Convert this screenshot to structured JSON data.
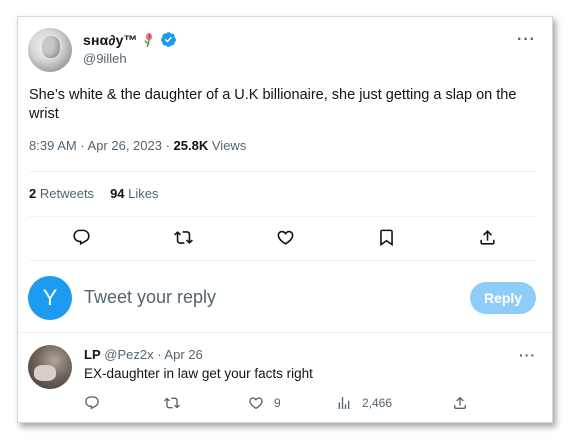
{
  "tweet": {
    "display_name": "ѕнα∂у™",
    "handle": "@9illeh",
    "text": "She’s white & the daughter of a U.K billionaire, she just getting a slap on the wrist",
    "time": "8:39 AM · Apr 26, 2023 ·",
    "views_count": "25.8K",
    "views_label": "Views",
    "retweets_count": "2",
    "retweets_label": "Retweets",
    "likes_count": "94",
    "likes_label": "Likes",
    "more": "···"
  },
  "composer": {
    "avatar_letter": "Y",
    "placeholder": "Tweet your reply",
    "reply_button": "Reply"
  },
  "reply": {
    "name": "LP",
    "handle_date": "@Pez2x · Apr 26",
    "text": "EX-daughter in law get your facts right",
    "more": "···",
    "likes": "9",
    "views": "2,466"
  },
  "colors": {
    "accent": "#1d9bf0",
    "reply_button_disabled": "#8ecdf8",
    "secondary_text": "#536471",
    "border": "#cfd9de"
  },
  "icons": {
    "flower": "rose-icon",
    "verified": "verified-badge-icon",
    "reply": "reply-icon",
    "retweet": "retweet-icon",
    "like": "heart-icon",
    "bookmark": "bookmark-icon",
    "share": "share-icon",
    "views": "analytics-icon"
  }
}
